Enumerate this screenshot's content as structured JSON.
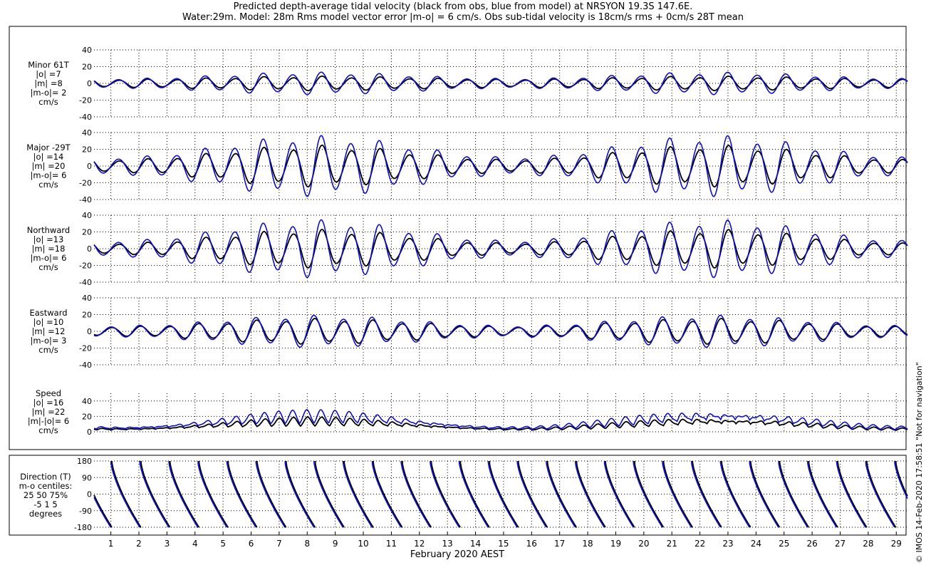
{
  "header": {
    "title_line1": "Predicted depth-average tidal velocity (black from obs, blue from model) at NRSYON 19.3S 147.6E.",
    "title_line2": "Water:29m. Model: 28m  Rms model vector error |m-o| = 6 cm/s. Obs sub-tidal velocity is 18cm/s rms + 0cm/s 28T mean"
  },
  "credit": "© IMOS 14-Feb-2020 17:58:51  \"Not for navigation\"",
  "colors": {
    "obs": "#000000",
    "model": "#1010c8",
    "grid": "#000000"
  },
  "chart_data": {
    "type": "line",
    "xlabel": "February 2020 AEST",
    "x_ticks": [
      "1",
      "2",
      "3",
      "4",
      "5",
      "6",
      "7",
      "8",
      "9",
      "10",
      "11",
      "12",
      "13",
      "14",
      "15",
      "16",
      "17",
      "18",
      "19",
      "20",
      "21",
      "22",
      "23",
      "24",
      "25",
      "26",
      "27",
      "28",
      "29"
    ],
    "xlim": [
      0.4,
      29.4
    ],
    "series_names": [
      "obs",
      "model"
    ],
    "panels": [
      {
        "id": "minor",
        "label_lines": [
          "Minor 61T",
          "|o| =7",
          "|m| =8",
          "|m-o|= 2",
          "cm/s"
        ],
        "ylim": [
          -40,
          40
        ],
        "yticks": [
          "40",
          "20",
          "0",
          "-20",
          "-40"
        ],
        "amp_obs": [
          5,
          9
        ],
        "amp_model": [
          6,
          14
        ],
        "phase_shift": 0.0
      },
      {
        "id": "major",
        "label_lines": [
          "Major -29T",
          "|o| =14",
          "|m| =20",
          "|m-o|= 6",
          "cm/s"
        ],
        "ylim": [
          -40,
          40
        ],
        "yticks": [
          "40",
          "20",
          "0",
          "-20",
          "-40"
        ],
        "amp_obs": [
          8,
          26
        ],
        "amp_model": [
          11,
          38
        ],
        "phase_shift": 0.0
      },
      {
        "id": "north",
        "label_lines": [
          "Northward",
          "|o| =13",
          "|m| =18",
          "|m-o|= 6",
          "cm/s"
        ],
        "ylim": [
          -40,
          40
        ],
        "yticks": [
          "40",
          "20",
          "0",
          "-20",
          "-40"
        ],
        "amp_obs": [
          7,
          24
        ],
        "amp_model": [
          10,
          36
        ],
        "phase_shift": 0.0
      },
      {
        "id": "east",
        "label_lines": [
          "Eastward",
          "|o| =10",
          "|m| =12",
          "|m-o|= 3",
          "cm/s"
        ],
        "ylim": [
          -40,
          40
        ],
        "yticks": [
          "40",
          "20",
          "0",
          "-20",
          "-40"
        ],
        "amp_obs": [
          6,
          16
        ],
        "amp_model": [
          7,
          20
        ],
        "phase_shift": 0.25
      },
      {
        "id": "speed",
        "label_lines": [
          "Speed",
          "|o| =16",
          "|m| =22",
          "|m|-|o|= 6",
          "cm/s"
        ],
        "ylim": [
          0,
          50
        ],
        "yticks": [
          "40",
          "20",
          "0"
        ],
        "amp_obs": [
          6,
          24
        ],
        "amp_model": [
          9,
          36
        ],
        "phase_shift": 0.0
      },
      {
        "id": "direction",
        "label_lines": [
          "Direction (T)",
          "m-o centiles:",
          "25  50  75%",
          "-5  1  5",
          "degrees"
        ],
        "ylim": [
          -180,
          180
        ],
        "yticks": [
          "180",
          "90",
          "0",
          "-90",
          "-180"
        ]
      }
    ]
  }
}
